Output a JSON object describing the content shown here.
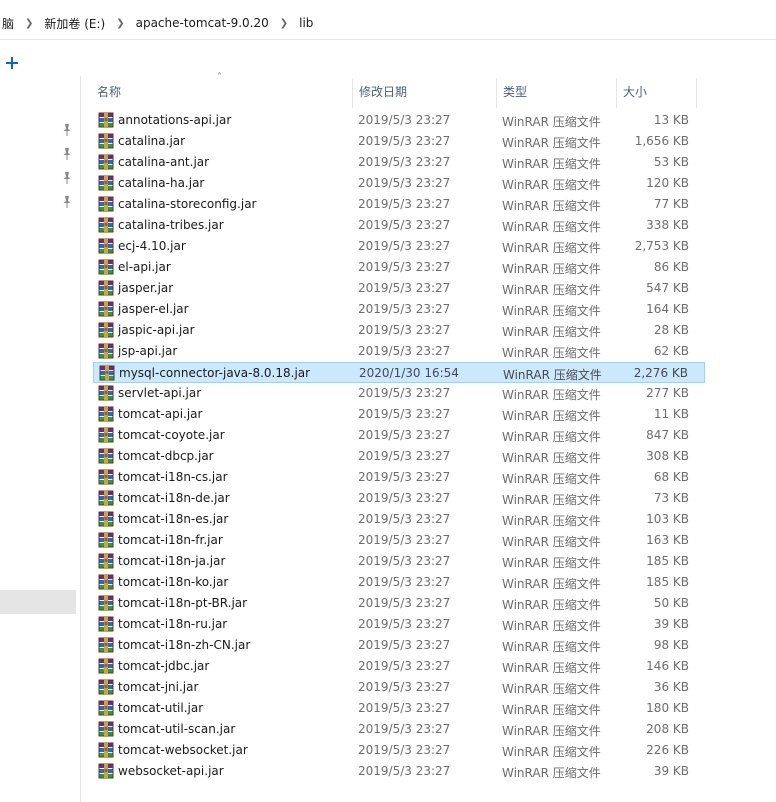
{
  "breadcrumb": [
    "脑",
    "新加卷 (E:)",
    "apache-tomcat-9.0.20",
    "lib"
  ],
  "columns": {
    "name": "名称",
    "date": "修改日期",
    "type": "类型",
    "size": "大小"
  },
  "files": [
    {
      "name": "annotations-api.jar",
      "date": "2019/5/3 23:27",
      "type": "WinRAR 压缩文件",
      "size": "13 KB"
    },
    {
      "name": "catalina.jar",
      "date": "2019/5/3 23:27",
      "type": "WinRAR 压缩文件",
      "size": "1,656 KB"
    },
    {
      "name": "catalina-ant.jar",
      "date": "2019/5/3 23:27",
      "type": "WinRAR 压缩文件",
      "size": "53 KB"
    },
    {
      "name": "catalina-ha.jar",
      "date": "2019/5/3 23:27",
      "type": "WinRAR 压缩文件",
      "size": "120 KB"
    },
    {
      "name": "catalina-storeconfig.jar",
      "date": "2019/5/3 23:27",
      "type": "WinRAR 压缩文件",
      "size": "77 KB"
    },
    {
      "name": "catalina-tribes.jar",
      "date": "2019/5/3 23:27",
      "type": "WinRAR 压缩文件",
      "size": "338 KB"
    },
    {
      "name": "ecj-4.10.jar",
      "date": "2019/5/3 23:27",
      "type": "WinRAR 压缩文件",
      "size": "2,753 KB"
    },
    {
      "name": "el-api.jar",
      "date": "2019/5/3 23:27",
      "type": "WinRAR 压缩文件",
      "size": "86 KB"
    },
    {
      "name": "jasper.jar",
      "date": "2019/5/3 23:27",
      "type": "WinRAR 压缩文件",
      "size": "547 KB"
    },
    {
      "name": "jasper-el.jar",
      "date": "2019/5/3 23:27",
      "type": "WinRAR 压缩文件",
      "size": "164 KB"
    },
    {
      "name": "jaspic-api.jar",
      "date": "2019/5/3 23:27",
      "type": "WinRAR 压缩文件",
      "size": "28 KB"
    },
    {
      "name": "jsp-api.jar",
      "date": "2019/5/3 23:27",
      "type": "WinRAR 压缩文件",
      "size": "62 KB"
    },
    {
      "name": "mysql-connector-java-8.0.18.jar",
      "date": "2020/1/30 16:54",
      "type": "WinRAR 压缩文件",
      "size": "2,276 KB",
      "selected": true
    },
    {
      "name": "servlet-api.jar",
      "date": "2019/5/3 23:27",
      "type": "WinRAR 压缩文件",
      "size": "277 KB"
    },
    {
      "name": "tomcat-api.jar",
      "date": "2019/5/3 23:27",
      "type": "WinRAR 压缩文件",
      "size": "11 KB"
    },
    {
      "name": "tomcat-coyote.jar",
      "date": "2019/5/3 23:27",
      "type": "WinRAR 压缩文件",
      "size": "847 KB"
    },
    {
      "name": "tomcat-dbcp.jar",
      "date": "2019/5/3 23:27",
      "type": "WinRAR 压缩文件",
      "size": "308 KB"
    },
    {
      "name": "tomcat-i18n-cs.jar",
      "date": "2019/5/3 23:27",
      "type": "WinRAR 压缩文件",
      "size": "68 KB"
    },
    {
      "name": "tomcat-i18n-de.jar",
      "date": "2019/5/3 23:27",
      "type": "WinRAR 压缩文件",
      "size": "73 KB"
    },
    {
      "name": "tomcat-i18n-es.jar",
      "date": "2019/5/3 23:27",
      "type": "WinRAR 压缩文件",
      "size": "103 KB"
    },
    {
      "name": "tomcat-i18n-fr.jar",
      "date": "2019/5/3 23:27",
      "type": "WinRAR 压缩文件",
      "size": "163 KB"
    },
    {
      "name": "tomcat-i18n-ja.jar",
      "date": "2019/5/3 23:27",
      "type": "WinRAR 压缩文件",
      "size": "185 KB"
    },
    {
      "name": "tomcat-i18n-ko.jar",
      "date": "2019/5/3 23:27",
      "type": "WinRAR 压缩文件",
      "size": "185 KB"
    },
    {
      "name": "tomcat-i18n-pt-BR.jar",
      "date": "2019/5/3 23:27",
      "type": "WinRAR 压缩文件",
      "size": "50 KB"
    },
    {
      "name": "tomcat-i18n-ru.jar",
      "date": "2019/5/3 23:27",
      "type": "WinRAR 压缩文件",
      "size": "39 KB"
    },
    {
      "name": "tomcat-i18n-zh-CN.jar",
      "date": "2019/5/3 23:27",
      "type": "WinRAR 压缩文件",
      "size": "98 KB"
    },
    {
      "name": "tomcat-jdbc.jar",
      "date": "2019/5/3 23:27",
      "type": "WinRAR 压缩文件",
      "size": "146 KB"
    },
    {
      "name": "tomcat-jni.jar",
      "date": "2019/5/3 23:27",
      "type": "WinRAR 压缩文件",
      "size": "36 KB"
    },
    {
      "name": "tomcat-util.jar",
      "date": "2019/5/3 23:27",
      "type": "WinRAR 压缩文件",
      "size": "180 KB"
    },
    {
      "name": "tomcat-util-scan.jar",
      "date": "2019/5/3 23:27",
      "type": "WinRAR 压缩文件",
      "size": "208 KB"
    },
    {
      "name": "tomcat-websocket.jar",
      "date": "2019/5/3 23:27",
      "type": "WinRAR 压缩文件",
      "size": "226 KB"
    },
    {
      "name": "websocket-api.jar",
      "date": "2019/5/3 23:27",
      "type": "WinRAR 压缩文件",
      "size": "39 KB"
    }
  ],
  "icons": {
    "file": "winrar-archive-icon",
    "pin": "pin-icon",
    "add": "plus-icon",
    "sort": "sort-ascending-icon",
    "separator": "chevron-right-icon"
  },
  "colors": {
    "selected_bg": "#cce8ff",
    "selected_border": "#99d1ff",
    "header_text": "#4c607a",
    "accent": "#0a64d0"
  }
}
